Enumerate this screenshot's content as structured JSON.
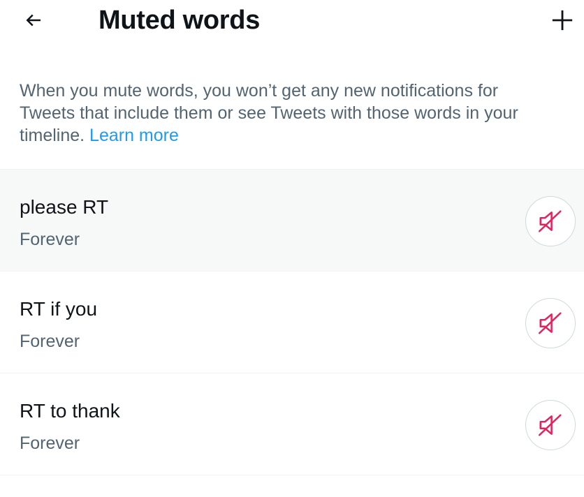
{
  "header": {
    "title": "Muted words",
    "back_icon": "arrow-left-icon",
    "add_icon": "plus-icon"
  },
  "description": {
    "text": "When you mute words, you won’t get any new notifications for Tweets that include them or see Tweets with those words in your timeline. ",
    "link_label": "Learn more"
  },
  "muted_words": [
    {
      "word": "please RT",
      "duration": "Forever",
      "icon": "speaker-muted-icon"
    },
    {
      "word": "RT if you",
      "duration": "Forever",
      "icon": "speaker-muted-icon"
    },
    {
      "word": "RT to thank",
      "duration": "Forever",
      "icon": "speaker-muted-icon"
    }
  ],
  "colors": {
    "link": "#1d9bf0",
    "unmute_icon": "#e0245e",
    "secondary_text": "#536471"
  }
}
